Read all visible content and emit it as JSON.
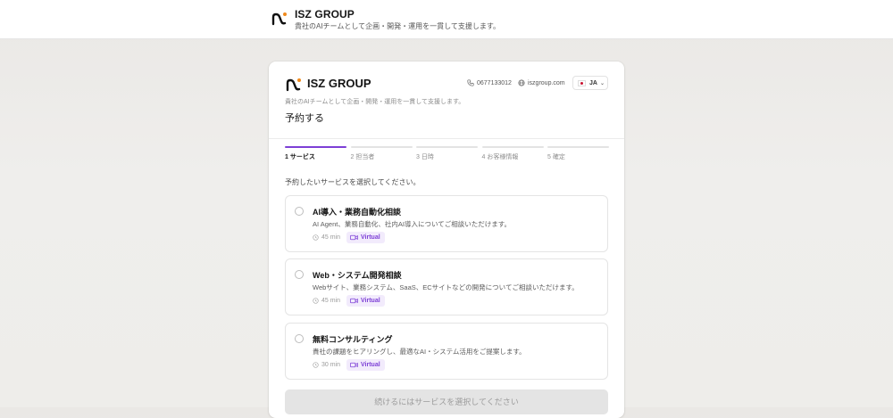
{
  "topbar": {
    "title": "ISZ GROUP",
    "subtitle": "貴社のAIチームとして企画・開発・運用を一貫して支援します。",
    "logo_icon": "isz-logo-icon"
  },
  "card": {
    "brand": "ISZ GROUP",
    "phone": "0677133012",
    "website": "iszgroup.com",
    "language": "JA",
    "tagline": "貴社のAIチームとして企画・開発・運用を一貫して支援します。",
    "heading": "予約する"
  },
  "steps": [
    {
      "number": "1",
      "label": "サービス",
      "active": true
    },
    {
      "number": "2",
      "label": "担当者",
      "active": false
    },
    {
      "number": "3",
      "label": "日時",
      "active": false
    },
    {
      "number": "4",
      "label": "お客様情報",
      "active": false
    },
    {
      "number": "5",
      "label": "確定",
      "active": false
    }
  ],
  "prompt": "予約したいサービスを選択してください。",
  "services": [
    {
      "title": "AI導入・業務自動化相談",
      "description": "AI Agent、業務自動化、社内AI導入についてご相談いただけます。",
      "duration": "45 min",
      "mode": "Virtual"
    },
    {
      "title": "Web・システム開発相談",
      "description": "Webサイト、業務システム、SaaS、ECサイトなどの開発についてご相談いただけます。",
      "duration": "45 min",
      "mode": "Virtual"
    },
    {
      "title": "無料コンサルティング",
      "description": "貴社の課題をヒアリングし、最適なAI・システム活用をご提案します。",
      "duration": "30 min",
      "mode": "Virtual"
    }
  ],
  "continue_button": "続けるにはサービスを選択してください",
  "colors": {
    "accent": "#7d3fd6",
    "logo_dot": "#f08a1c",
    "badge_bg": "#f2ebfc"
  }
}
